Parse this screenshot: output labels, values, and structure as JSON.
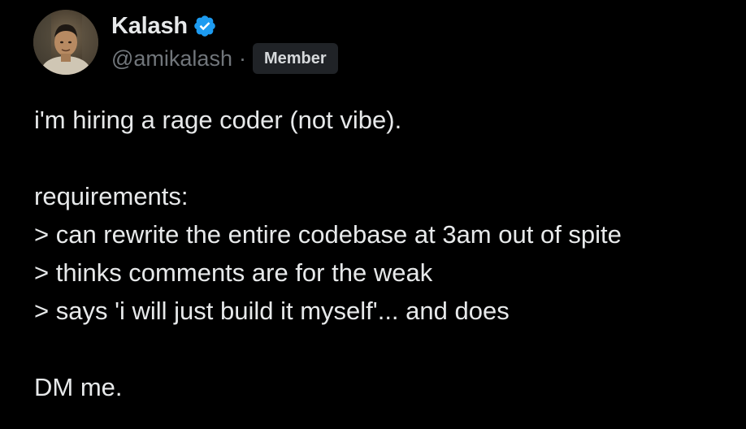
{
  "author": {
    "display_name": "Kalash",
    "handle": "@amikalash",
    "separator": "·",
    "badge": "Member",
    "verified": true,
    "verified_color": "#1d9bf0"
  },
  "tweet": {
    "lines": [
      "i'm hiring a rage coder (not vibe).",
      "",
      "requirements:",
      "> can rewrite the entire codebase at 3am out of spite",
      "> thinks comments are for the weak",
      "> says 'i will just build it myself'... and does",
      "",
      "DM me."
    ]
  },
  "colors": {
    "background": "#000000",
    "text": "#e7e9ea",
    "muted": "#71767b",
    "badge_bg": "#202327"
  },
  "icons": {
    "verified": "verified-badge-icon",
    "avatar": "avatar"
  }
}
